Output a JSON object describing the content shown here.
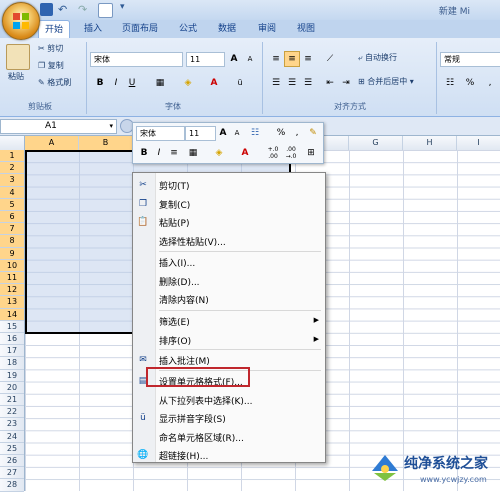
{
  "title_bar": {
    "doc_title": "新建 Mi"
  },
  "ribbon": {
    "tabs": [
      "开始",
      "插入",
      "页面布局",
      "公式",
      "数据",
      "审阅",
      "视图"
    ],
    "clipboard": {
      "cut": "剪切",
      "copy": "复制",
      "format_painter": "格式刷",
      "paste": "粘贴",
      "label": "剪贴板"
    },
    "font": {
      "name": "宋体",
      "size": "11",
      "label": "字体",
      "bold": "B",
      "italic": "I",
      "underline": "U",
      "grow": "A",
      "shrink": "A",
      "color_a": "A"
    },
    "alignment": {
      "wrap": "自动换行",
      "merge": "合并后居中",
      "label": "对齐方式"
    },
    "number": {
      "format": "常规",
      "percent": "%",
      "comma": ","
    }
  },
  "formula_bar": {
    "name_box": "A1",
    "fx": "fx"
  },
  "grid": {
    "columns": [
      "A",
      "B",
      "C",
      "D",
      "E",
      "F",
      "G",
      "H",
      "I"
    ],
    "rows": [
      "1",
      "2",
      "3",
      "4",
      "5",
      "6",
      "7",
      "8",
      "9",
      "10",
      "11",
      "12",
      "13",
      "14",
      "15",
      "16",
      "17",
      "18",
      "19",
      "20",
      "21",
      "22",
      "23",
      "24",
      "25",
      "26",
      "27",
      "28"
    ]
  },
  "mini_toolbar": {
    "font": "宋体",
    "size": "11",
    "grow": "A",
    "shrink": "A",
    "percent": "%",
    "comma": ",",
    "bold": "B",
    "italic": "I",
    "color_a": "A",
    "inc": "+.0\n.00",
    "dec": ".00\n→.0"
  },
  "context_menu": {
    "items": [
      {
        "label": "剪切(T)",
        "icon": "scissors-icon"
      },
      {
        "label": "复制(C)",
        "icon": "copy-icon"
      },
      {
        "label": "粘贴(P)",
        "icon": "paste-icon"
      },
      {
        "label": "选择性粘贴(V)...",
        "icon": ""
      },
      {
        "label": "插入(I)...",
        "icon": ""
      },
      {
        "label": "删除(D)...",
        "icon": ""
      },
      {
        "label": "清除内容(N)",
        "icon": ""
      },
      {
        "label": "筛选(E)",
        "icon": "",
        "submenu": true
      },
      {
        "label": "排序(O)",
        "icon": "",
        "submenu": true
      },
      {
        "label": "插入批注(M)",
        "icon": "comment-icon"
      },
      {
        "label": "设置单元格格式(F)...",
        "icon": "format-cells-icon",
        "highlighted": true
      },
      {
        "label": "从下拉列表中选择(K)...",
        "icon": ""
      },
      {
        "label": "显示拼音字段(S)",
        "icon": "phonetic-icon"
      },
      {
        "label": "命名单元格区域(R)...",
        "icon": ""
      },
      {
        "label": "超链接(H)...",
        "icon": "hyperlink-icon"
      }
    ]
  },
  "watermark": {
    "brand": "纯净系统之家",
    "url": "www.ycwjzy.com"
  },
  "colors": {
    "ribbon": "#cfdff3",
    "selection": "#ffd58b",
    "highlight_box": "#c0272d"
  }
}
